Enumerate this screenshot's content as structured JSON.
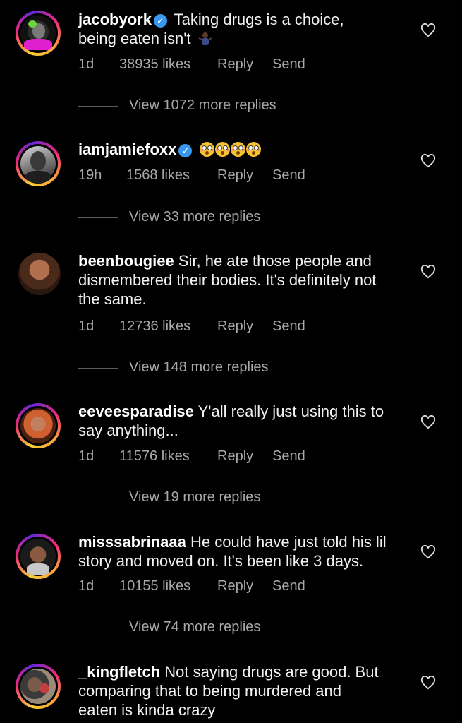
{
  "comments": [
    {
      "username": "jacobyork",
      "verified": true,
      "text_line1": "Taking drugs is a choice,",
      "text_line2": "being eaten isn't",
      "emoji": "person-shrugging-icon",
      "time": "1d",
      "likes": "38935 likes",
      "reply": "Reply",
      "send": "Send",
      "view_replies": "View 1072 more replies"
    },
    {
      "username": "iamjamiefoxx",
      "verified": true,
      "emoji_text": "flushed-face-icon x4",
      "time": "19h",
      "likes": "1568 likes",
      "reply": "Reply",
      "send": "Send",
      "view_replies": "View 33 more replies"
    },
    {
      "username": "beenbougiee",
      "text_line1": "Sir, he ate those people and",
      "text_line2": "dismembered their bodies. It's definitely not",
      "text_line3": "the same.",
      "time": "1d",
      "likes": "12736 likes",
      "reply": "Reply",
      "send": "Send",
      "view_replies": "View 148 more replies"
    },
    {
      "username": "eeveesparadise",
      "text_line1": "Y'all really just using this to",
      "text_line2": "say anything...",
      "time": "1d",
      "likes": "11576 likes",
      "reply": "Reply",
      "send": "Send",
      "view_replies": "View 19 more replies"
    },
    {
      "username": "misssabrinaaa",
      "text_line1": "He could have just told his lil",
      "text_line2": "story and moved on. It's been like 3 days.",
      "time": "1d",
      "likes": "10155 likes",
      "reply": "Reply",
      "send": "Send",
      "view_replies": "View 74 more replies"
    },
    {
      "username": "_kingfletch",
      "text_line1": "Not saying drugs are good. But",
      "text_line2": "comparing that to being murdered and",
      "text_line3": "eaten is kinda crazy"
    }
  ],
  "colors": {
    "background": "#000000",
    "text": "#f2f2f2",
    "secondary_text": "#a8a8a8",
    "verified_badge": "#3897f0"
  }
}
